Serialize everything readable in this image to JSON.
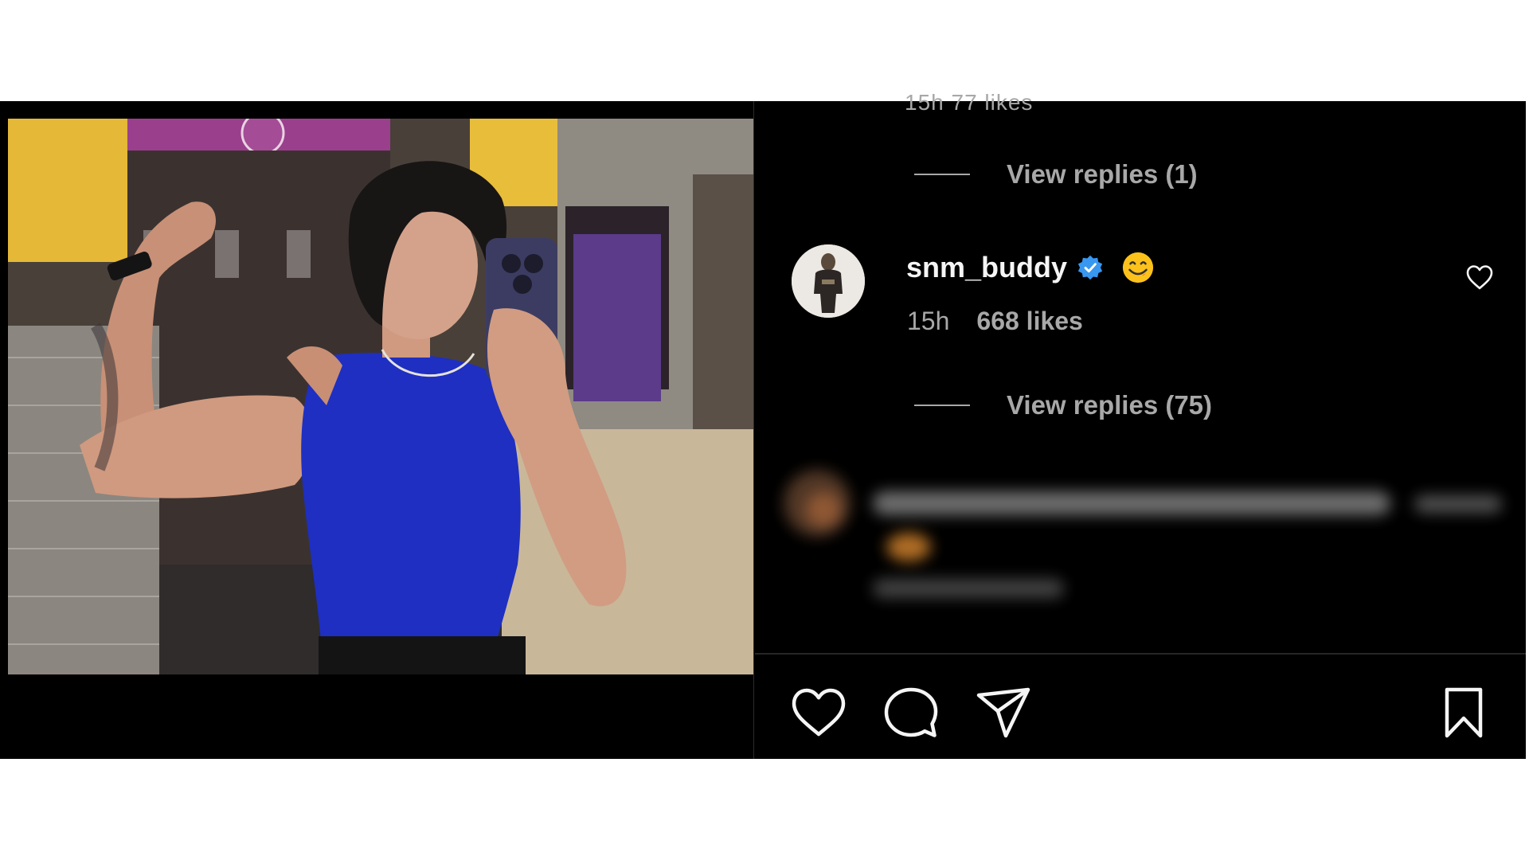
{
  "comments": {
    "previous_meta_partial": "15h   77 likes",
    "view_replies_first": "View replies (1)",
    "comment": {
      "username": "snm_buddy",
      "verified": true,
      "emoji_icon": "face-savoring-food-emoji",
      "time": "15h",
      "likes": "668 likes",
      "view_replies": "View replies (75)"
    },
    "blurred_comment_icon": "blurred-comment-placeholder"
  },
  "actions": {
    "like_icon": "heart-icon",
    "comment_icon": "comment-bubble-icon",
    "share_icon": "paper-plane-icon",
    "save_icon": "bookmark-icon"
  },
  "colors": {
    "background": "#000000",
    "text_primary": "#f5f5f5",
    "text_secondary": "#a8a8a8",
    "verified_blue": "#3897f0",
    "page_white": "#ffffff"
  }
}
